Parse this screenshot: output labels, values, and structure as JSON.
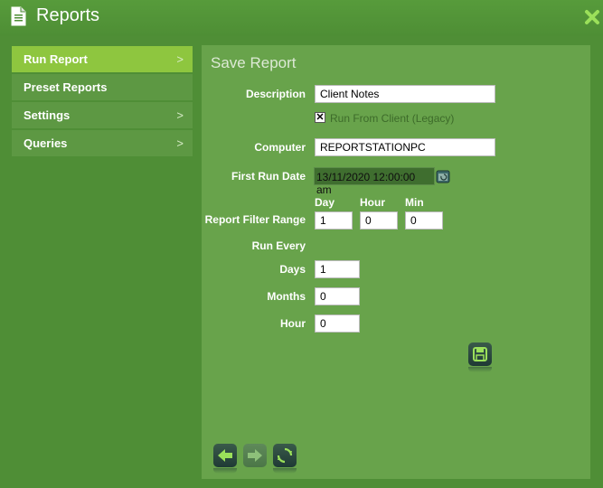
{
  "window": {
    "title": "Reports"
  },
  "sidebar": {
    "items": [
      {
        "label": "Run Report",
        "chevron": ">",
        "active": true
      },
      {
        "label": "Preset Reports",
        "chevron": ""
      },
      {
        "label": "Settings",
        "chevron": ">"
      },
      {
        "label": "Queries",
        "chevron": ">"
      }
    ]
  },
  "form": {
    "title": "Save Report",
    "description": {
      "label": "Description",
      "value": "Client Notes"
    },
    "run_from_client": {
      "label": "Run From Client (Legacy)",
      "checked": true,
      "mark": "✕"
    },
    "computer": {
      "label": "Computer",
      "value": "REPORTSTATIONPC"
    },
    "first_run_date": {
      "label": "First Run Date",
      "value": "13/11/2020 12:00:00 am"
    },
    "filter_range": {
      "label": "Report Filter Range",
      "day_label": "Day",
      "day_value": "1",
      "hour_label": "Hour",
      "hour_value": "0",
      "min_label": "Min",
      "min_value": "0"
    },
    "run_every": {
      "label": "Run Every",
      "days_label": "Days",
      "days_value": "1",
      "months_label": "Months",
      "months_value": "0",
      "hour_label": "Hour",
      "hour_value": "0"
    }
  },
  "icons": {
    "title": "document-icon",
    "close": "close-icon",
    "save": "save-icon",
    "back": "back-arrow-icon",
    "forward": "forward-arrow-icon",
    "refresh": "refresh-icon",
    "calendar": "calendar-icon"
  },
  "colors": {
    "background": "#4f8e36",
    "panel": "#68a34b",
    "active_item": "#8ec63f",
    "close": "#9be05a"
  }
}
